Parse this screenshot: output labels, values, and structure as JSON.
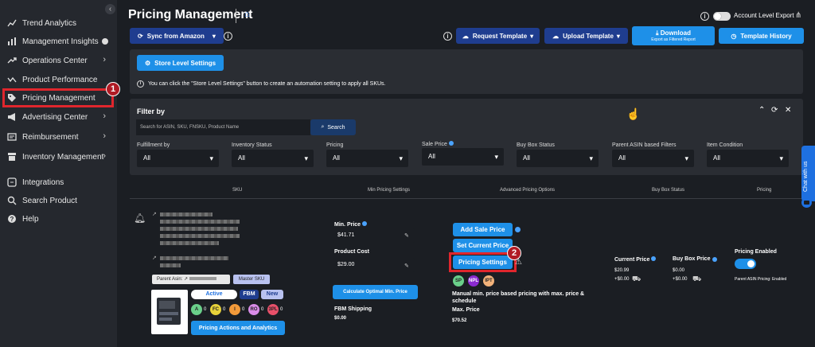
{
  "sidebar": {
    "items": [
      {
        "label": "Trend Analytics",
        "icon": "chart-line-icon"
      },
      {
        "label": "Management Insights",
        "icon": "bar-chart-icon"
      },
      {
        "label": "Operations Center",
        "icon": "trend-icon"
      },
      {
        "label": "Product Performance",
        "icon": "sparkline-icon"
      },
      {
        "label": "Pricing Management",
        "icon": "tag-icon"
      },
      {
        "label": "Advertising Center",
        "icon": "megaphone-icon"
      },
      {
        "label": "Reimbursement",
        "icon": "receipt-icon"
      },
      {
        "label": "Inventory Management",
        "icon": "box-icon"
      },
      {
        "label": "Integrations",
        "icon": "plug-icon"
      },
      {
        "label": "Search Product",
        "icon": "search-icon"
      },
      {
        "label": "Help",
        "icon": "help-icon"
      }
    ],
    "step1": "1"
  },
  "header": {
    "title": "Pricing Management",
    "account_export": "Account Level Export"
  },
  "toolbar": {
    "sync": "Sync from Amazon",
    "request_template": "Request Template",
    "upload_template": "Upload Template",
    "download": "Download",
    "download_sub": "Export as Filtered Report",
    "template_history": "Template History"
  },
  "store": {
    "button": "Store Level Settings",
    "info": "You can click the \"Store Level Settings\" button to create an automation setting to apply all SKUs."
  },
  "filter": {
    "title": "Filter by",
    "search_placeholder": "Search for ASIN, SKU, FNSKU, Product Name",
    "search_btn": "Search",
    "fields": [
      {
        "label": "Fulfillment by",
        "value": "All"
      },
      {
        "label": "Inventory Status",
        "value": "All"
      },
      {
        "label": "Pricing",
        "value": "All"
      },
      {
        "label": "Sale Price",
        "value": "All"
      },
      {
        "label": "Buy Box Status",
        "value": "All"
      },
      {
        "label": "Parent ASIN based Filters",
        "value": "All"
      },
      {
        "label": "Item Condition",
        "value": "All"
      }
    ]
  },
  "table": {
    "headers": [
      "SKU",
      "Min Pricing Settings",
      "Advanced Pricing Options",
      "Buy Box Status",
      "Pricing"
    ]
  },
  "row": {
    "parent_asin": "Parent Asin:",
    "master_sku": "Master SKU",
    "status": "Active",
    "fbm": "FBM",
    "new": "New",
    "circles": [
      {
        "t": "A",
        "n": "0",
        "c": "#6ad08a"
      },
      {
        "t": "FC",
        "n": "0",
        "c": "#e7d23a"
      },
      {
        "t": "I",
        "n": "0",
        "c": "#f29a3a"
      },
      {
        "t": "RO",
        "n": "0",
        "c": "#d98ce8"
      },
      {
        "t": "3PL",
        "n": "0",
        "c": "#e8506a"
      }
    ],
    "actions_btn": "Pricing Actions and Analytics",
    "min_price_label": "Min. Price",
    "min_price": "$41.71",
    "product_cost_label": "Product Cost",
    "product_cost": "$29.00",
    "calc_btn": "Calculate Optimal Min. Price",
    "fbm_label": "FBM Shipping",
    "fbm_value": "$0.00",
    "add_sale": "Add Sale Price",
    "set_current": "Set Current Price",
    "pricing_settings": "Pricing Settings",
    "tags": [
      "SP",
      "NPL",
      "IPT"
    ],
    "manual_text": "Manual min. price based pricing with max. price & schedule",
    "max_label": "Max. Price",
    "max_value": "$70.52",
    "current_label": "Current Price",
    "current_value": "$20.99",
    "current_ship": "+$0.00",
    "buybox_label": "Buy Box Price",
    "buybox_value": "$0.00",
    "buybox_ship": "+$0.00",
    "pricing_enabled": "Pricing Enabled",
    "parent_enabled": "Parent ASIN Pricing: Enabled",
    "step2": "2"
  },
  "chat": "Chat with us"
}
